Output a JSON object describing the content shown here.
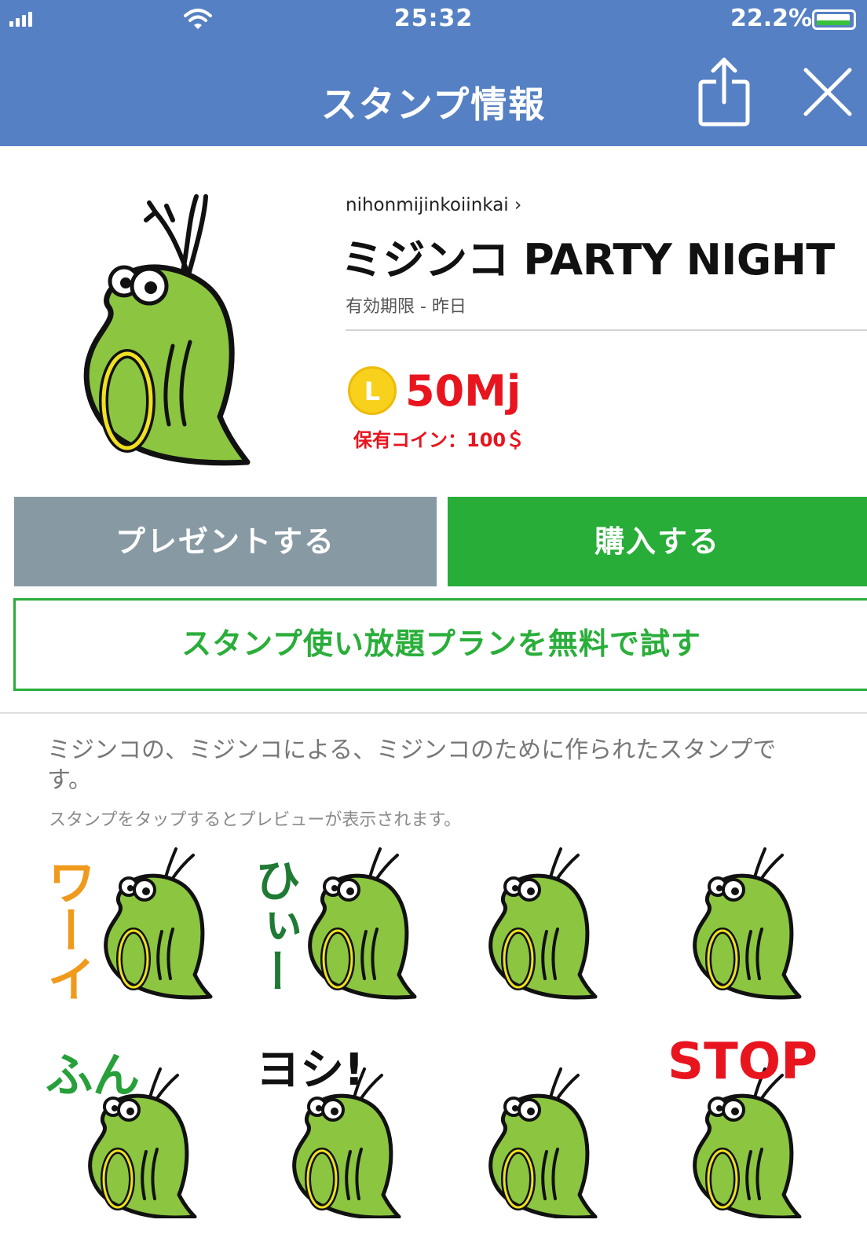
{
  "status_bar": {
    "time": "25:32",
    "battery": "22.2%"
  },
  "nav": {
    "title": "スタンプ情報",
    "share_icon": "share-icon",
    "close_icon": "close-icon"
  },
  "product": {
    "author": "nihonmijinkoiinkai ›",
    "title": "ミジンコ PARTY NIGHT",
    "validity": "有効期限 - 昨日",
    "coin_letter": "L",
    "price": "50Mj",
    "owned_coins": "保有コイン：100＄"
  },
  "buttons": {
    "present": "プレゼントする",
    "buy": "購入する",
    "plan": "スタンプ使い放題プランを無料で試す"
  },
  "description": "ミジンコの、ミジンコによる、ミジンコのために作られたスタンプです。",
  "hint": "スタンプをタップするとプレビューが表示されます。",
  "stickers": [
    {
      "text": "ワーイ"
    },
    {
      "text": "ひぃー"
    },
    {
      "text": ""
    },
    {
      "text": ""
    },
    {
      "text": "ふん"
    },
    {
      "text": "ヨシ!"
    },
    {
      "text": ""
    },
    {
      "text": "STOP"
    }
  ],
  "colors": {
    "header": "#5680c4",
    "accent_green": "#27ad38",
    "present_gray": "#8799a3",
    "price_red": "#e8141e",
    "coin_yellow": "#f7d11c",
    "body_green": "#8cc540",
    "eye_yellow": "#f0e020"
  }
}
